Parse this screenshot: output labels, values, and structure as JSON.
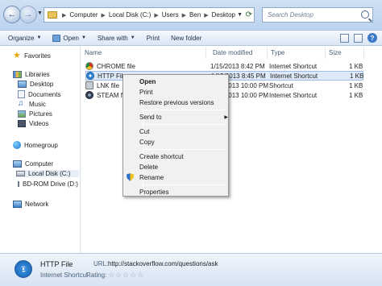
{
  "address_bar": {
    "crumbs": [
      "Computer",
      "Local Disk (C:)",
      "Users",
      "Ben",
      "Desktop"
    ],
    "search_placeholder": "Search Desktop"
  },
  "toolbar": {
    "organize": "Organize",
    "open": "Open",
    "share_with": "Share with",
    "print": "Print",
    "new_folder": "New folder"
  },
  "nav_pane": {
    "favorites": "Favorites",
    "libraries": "Libraries",
    "desktop": "Desktop",
    "documents": "Documents",
    "music": "Music",
    "pictures": "Pictures",
    "videos": "Videos",
    "homegroup": "Homegroup",
    "computer": "Computer",
    "local_disk": "Local Disk (C:)",
    "bd_rom": "BD-ROM Drive (D:) G",
    "network": "Network"
  },
  "columns": {
    "name": "Name",
    "date_modified": "Date modified",
    "type": "Type",
    "size": "Size"
  },
  "files": [
    {
      "name": "CHROME file",
      "date": "1/15/2013 8:42 PM",
      "type": "Internet Shortcut",
      "size": "1 KB",
      "icon": "chrome-icon"
    },
    {
      "name": "HTTP File",
      "date": "1/15/2013 8:45 PM",
      "type": "Internet Shortcut",
      "size": "1 KB",
      "icon": "ie-icon"
    },
    {
      "name": "LNK file",
      "date": "1/15/2013 10:00 PM",
      "type": "Shortcut",
      "size": "1 KB",
      "icon": "shortcut-icon"
    },
    {
      "name": "STEAM fil",
      "date": "1/15/2013 10:00 PM",
      "type": "Internet Shortcut",
      "size": "1 KB",
      "icon": "steam-icon"
    }
  ],
  "context_menu": {
    "open": "Open",
    "print": "Print",
    "restore": "Restore previous versions",
    "send_to": "Send to",
    "cut": "Cut",
    "copy": "Copy",
    "create_shortcut": "Create shortcut",
    "delete": "Delete",
    "rename": "Rename",
    "properties": "Properties"
  },
  "details": {
    "name": "HTTP File",
    "type": "Internet Shortcut",
    "url_label": "URL:",
    "url": "http://stackoverflow.com/questions/ask",
    "rating_label": "Rating:",
    "rating": 0,
    "rating_max": 5
  }
}
